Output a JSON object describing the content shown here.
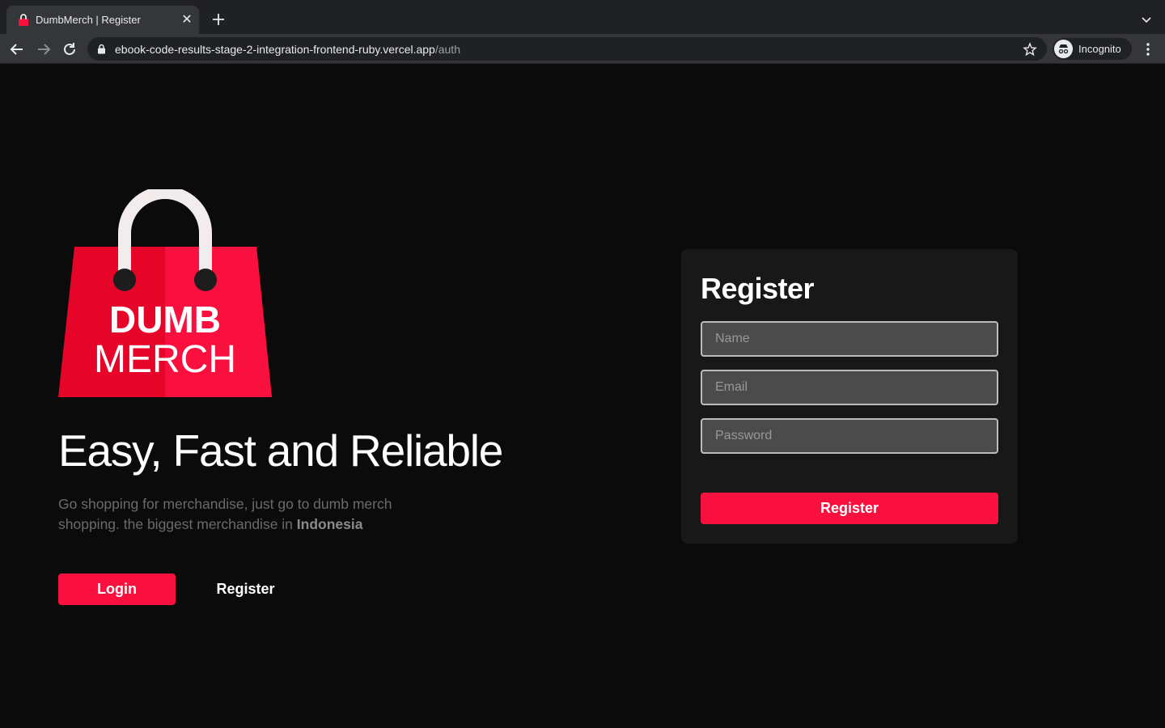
{
  "browser": {
    "tab_title": "DumbMerch | Register",
    "url_host": "ebook-code-results-stage-2-integration-frontend-ruby.vercel.app",
    "url_path": "/auth",
    "profile_label": "Incognito"
  },
  "brand": {
    "logo_line1": "DUMB",
    "logo_line2": "MERCH",
    "accent_color": "#f9103f"
  },
  "hero": {
    "headline": "Easy, Fast and Reliable",
    "description": "Go shopping for merchandise, just go to dumb merch shopping. the biggest merchandise in ",
    "description_bold": "Indonesia",
    "login_label": "Login",
    "register_label": "Register"
  },
  "register_form": {
    "title": "Register",
    "name_placeholder": "Name",
    "email_placeholder": "Email",
    "password_placeholder": "Password",
    "submit_label": "Register"
  }
}
